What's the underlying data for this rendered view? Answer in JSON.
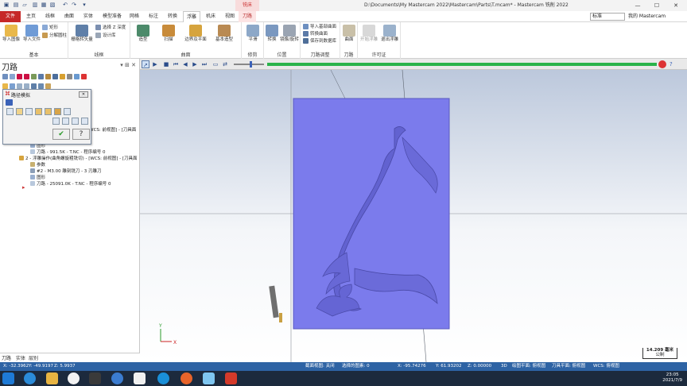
{
  "title_bar": {
    "context_tag": "铣床",
    "title": "D:\\Documents\\My Mastercam 2022\\Mastercam\\Parts\\T.mcam* - Mastercam 铣削 2022",
    "controls": [
      "—",
      "☐",
      "✕"
    ]
  },
  "menu": {
    "tabs": [
      "文件",
      "主页",
      "线框",
      "曲面",
      "实体",
      "模型准备",
      "网格",
      "标注",
      "转换",
      "浮雕",
      "机床",
      "视图",
      "刀路"
    ],
    "style_select": "标准",
    "my_mastercam": "我的 Mastercam"
  },
  "ribbon": {
    "groups": [
      {
        "label": "基本",
        "buttons": [
          "导入图像",
          "导入文件"
        ],
        "small": [
          "矩形",
          "分解圆柱"
        ]
      },
      {
        "label": "线框",
        "buttons": [
          "栅格转矢量"
        ],
        "small": [
          "选择 Z 深度",
          "设计库"
        ]
      },
      {
        "label": "曲面",
        "buttons": [
          "造型",
          "扫描",
          "边界及平面",
          "基本造型"
        ]
      },
      {
        "label": "修剪",
        "buttons": [
          "平滑"
        ]
      },
      {
        "label": "位置",
        "buttons": [
          "转换",
          "镜像/旋转"
        ]
      },
      {
        "label": "刀路调整",
        "small": [
          "导入基部曲面",
          "转换曲面",
          "保存到数据库"
        ]
      },
      {
        "label": "刀路",
        "buttons": [
          "曲面"
        ]
      },
      {
        "label": "许可证",
        "buttons": [
          "开始浮雕",
          "退出浮雕"
        ]
      }
    ]
  },
  "left_panel": {
    "title": "刀路",
    "tree": [
      "[WCS: 前视图] - [刀具面",
      "图形",
      "刀路 - 991.5K - T.NC - 程序编号 0",
      "2 - 浮雕操作(曲角螺旋粗铣切) - [WCS: 前视图] - [刀具面",
      "参数",
      "#2 - M3.00 雕刻铣刀 - 3 刃雕刀",
      "图形",
      "刀路 - 25091.0K - T.NC - 程序编号 0"
    ],
    "bottom_tabs": [
      "刀路",
      "实体",
      "层别"
    ]
  },
  "dialog": {
    "title": "路径模拟",
    "ok_glyph": "✔",
    "help_glyph": "?"
  },
  "viewport": {
    "axis_x": "X",
    "axis_y": "Y",
    "scale_value": "14.209 毫米",
    "scale_unit": "公制",
    "relief_color": "#7b7bec"
  },
  "status_bar": {
    "x": "X: -32.3962",
    "y": "Y: -49.9197",
    "z": "Z: 5.9937",
    "view": "截面视图: 关闭",
    "selected": "选择的图素: 0",
    "sx": "X: -95.74276",
    "sy": "Y: 61.93202",
    "sz": "Z: 0.00000",
    "mode": "3D",
    "plane": "绘图平面: 俯视图",
    "tool_plane": "刀具平面: 俯视图",
    "wcs": "WCS: 俯视图"
  },
  "taskbar": {
    "time": "23:05",
    "date": "2021/7/9"
  }
}
